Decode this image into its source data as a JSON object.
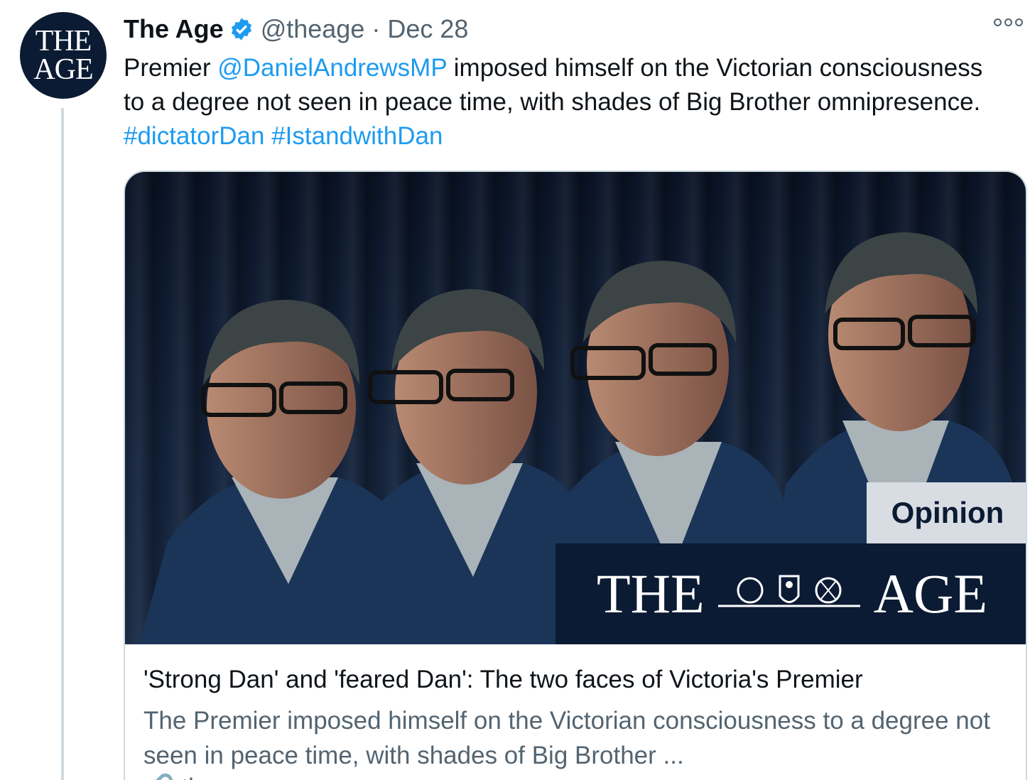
{
  "tweet": {
    "avatar_line1": "THE",
    "avatar_line2": "AGE",
    "display_name": "The Age",
    "handle": "@theage",
    "separator": "·",
    "date": "Dec 28",
    "text_pre": "Premier ",
    "mention": "@DanielAndrewsMP",
    "text_mid": " imposed himself on the Victorian consciousness to a degree not seen in peace time, with shades of Big Brother omnipresence. ",
    "hashtag1": "#dictatorDan",
    "hashtag2": "#IstandwithDan"
  },
  "card": {
    "badge": "Opinion",
    "masthead_left": "THE",
    "masthead_right": "AGE",
    "title": "'Strong Dan' and 'feared Dan': The two faces of Victoria's Premier",
    "description": "The Premier imposed himself on the Victorian consciousness to a degree not seen in peace time, with shades of Big Brother ...",
    "domain": "🔗 theage.com.au"
  },
  "colors": {
    "link": "#1d9bf0",
    "secondary_text": "#536471",
    "brand_navy": "#0b1b33",
    "border": "#cfd9de"
  }
}
